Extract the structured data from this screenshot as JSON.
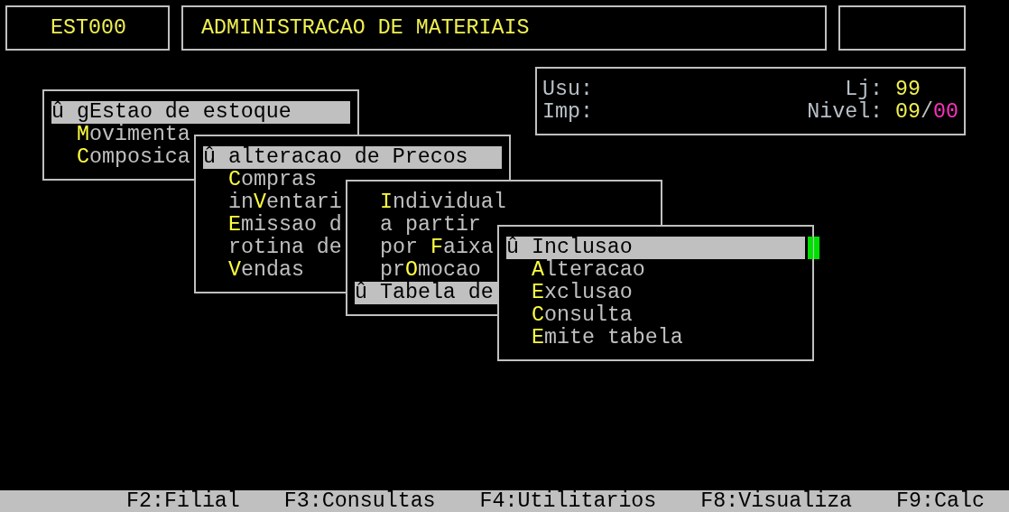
{
  "header": {
    "code": "EST000",
    "title": "ADMINISTRACAO DE MATERIAIS"
  },
  "info": {
    "rows": [
      {
        "left": "Usu:",
        "right_label": "Lj:",
        "right_value": [
          {
            "text": "99",
            "color": "#f0f050"
          }
        ]
      },
      {
        "left": "Imp:",
        "right_label": "Nivel:",
        "right_value": [
          {
            "text": "09",
            "color": "#f0f050"
          },
          {
            "text": "/",
            "color": "#c0c0c0"
          },
          {
            "text": "00",
            "color": "#ff30c0"
          }
        ]
      }
    ]
  },
  "menus": [
    {
      "items": [
        {
          "label": "û g**E**stao de estoque",
          "selected": true
        },
        {
          "label": "**M**ovimenta",
          "selected": false
        },
        {
          "label": "**C**omposica",
          "selected": false
        }
      ]
    },
    {
      "items": [
        {
          "label": "û alteracao de **P**recos",
          "selected": true
        },
        {
          "label": "**C**ompras",
          "selected": false
        },
        {
          "label": "in**V**entari",
          "selected": false
        },
        {
          "label": "**E**missao d",
          "selected": false
        },
        {
          "label": "rotina de",
          "selected": false
        },
        {
          "label": "**V**endas",
          "selected": false
        }
      ]
    },
    {
      "items": [
        {
          "label": "**I**ndividual",
          "selected": false
        },
        {
          "label": "a partir",
          "selected": false
        },
        {
          "label": "por **F**aixa",
          "selected": false
        },
        {
          "label": "pr**O**mocao",
          "selected": false
        },
        {
          "label": "û **T**abela de",
          "selected": true
        }
      ]
    },
    {
      "items": [
        {
          "label": "û **I**nclusao",
          "selected": true
        },
        {
          "label": "**A**lteracao",
          "selected": false
        },
        {
          "label": "**E**xclusao",
          "selected": false
        },
        {
          "label": "**C**onsulta",
          "selected": false
        },
        {
          "label": "**E**mite tabela",
          "selected": false
        }
      ]
    }
  ],
  "function_keys": [
    "F2:Filial",
    "F3:Consultas",
    "F4:Utilitarios",
    "F8:Visualiza",
    "F9:Calc"
  ]
}
